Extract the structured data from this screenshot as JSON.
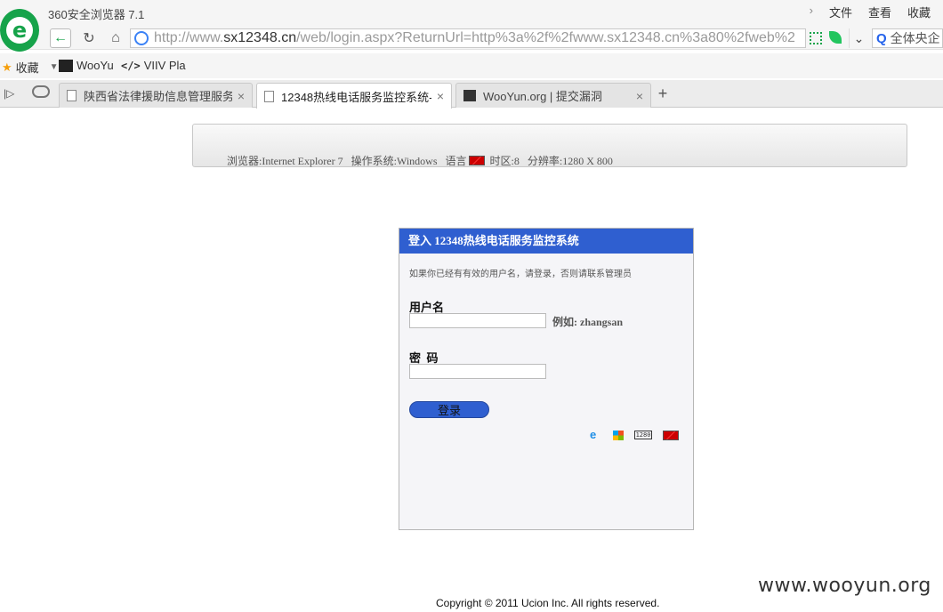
{
  "browser": {
    "title": "360安全浏览器 7.1",
    "menu": [
      "文件",
      "查看",
      "收藏"
    ],
    "url_host_prefix": "http://www.",
    "url_host": "sx12348.cn",
    "url_path": "/web/login.aspx?ReturnUrl=http%3a%2f%2fwww.sx12348.cn%3a80%2fweb%2",
    "search_text": "全体央企",
    "bookmarks": [
      "收藏",
      "WooYu",
      "VIIV Pla"
    ],
    "tabs": [
      {
        "label": "陕西省法律援助信息管理服务平",
        "active": false
      },
      {
        "label": "12348热线电话服务监控系统--",
        "active": true
      },
      {
        "label": "WooYun.org | 提交漏洞",
        "active": false
      }
    ],
    "colors": {
      "accent_green": "#16a34a",
      "header_blue": "#2f5fd0"
    }
  },
  "info_bar": {
    "browser_label": "浏览器:Internet Explorer 7",
    "os_label": "操作系统:Windows",
    "lang_label": "语言",
    "timezone_label": "时区:8",
    "resolution_label": "分辨率:1280 X 800"
  },
  "login": {
    "header": "登入 12348热线电话服务监控系统",
    "hint": "如果你已经有有效的用户名，请登录，否则请联系管理员",
    "username_label": "用户名",
    "username_example": "例如: zhangsan",
    "password_label": "密  码",
    "submit_label": "登录",
    "icons": [
      "ie-icon",
      "windows-icon",
      "resolution-1280-icon",
      "language-flag-icon"
    ]
  },
  "footer": {
    "copyright": "Copyright © 2011 Ucion Inc. All rights reserved.",
    "watermark": "www.wooyun.org"
  }
}
